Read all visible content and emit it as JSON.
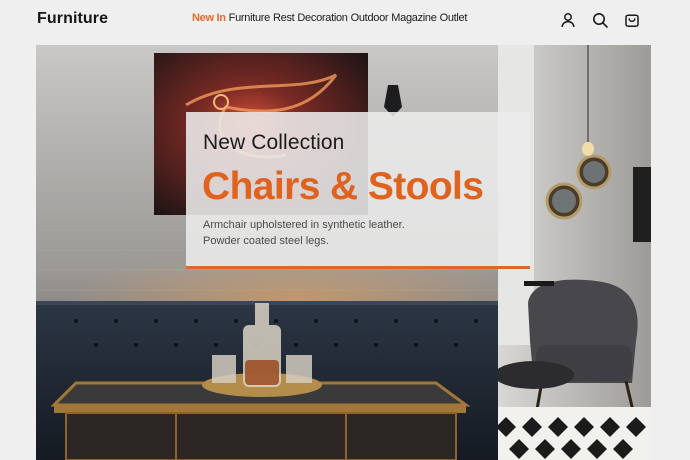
{
  "brand": {
    "name": "Furniture"
  },
  "nav": {
    "items": [
      {
        "label": "New In",
        "accent": true
      },
      {
        "label": "Furniture",
        "accent": false
      },
      {
        "label": "Rest",
        "accent": false
      },
      {
        "label": "Decoration",
        "accent": false
      },
      {
        "label": "Outdoor",
        "accent": false
      },
      {
        "label": "Magazine",
        "accent": false
      },
      {
        "label": "Outlet",
        "accent": false
      }
    ]
  },
  "header_icons": [
    "user-icon",
    "search-icon",
    "shopping-bag-icon"
  ],
  "hero": {
    "eyebrow": "New Collection",
    "title": "Chairs & Stools",
    "description_lines": [
      "Armchair upholstered in synthetic leather.",
      "Powder coated steel legs."
    ]
  },
  "colors": {
    "accent": "#e0621f",
    "page_background": "#efefef",
    "text": "#1b1b1b"
  }
}
